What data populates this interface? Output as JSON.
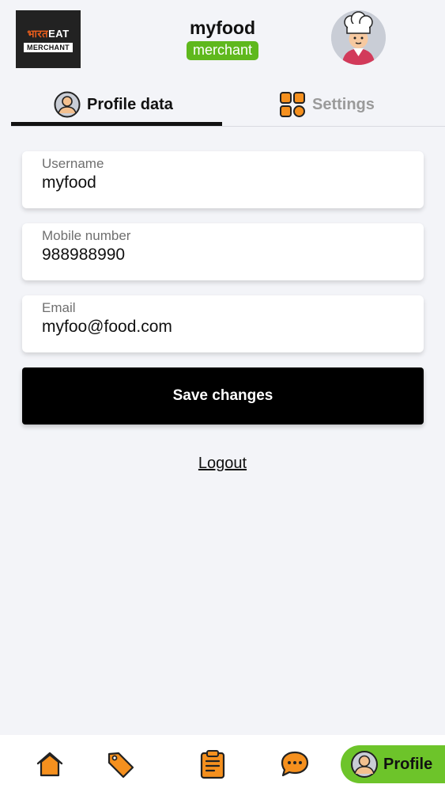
{
  "header": {
    "logo_top_a": "भारत",
    "logo_top_b": "EAT",
    "logo_bottom": "MERCHANT",
    "title": "myfood",
    "badge": "merchant"
  },
  "tabs": [
    {
      "label": "Profile data",
      "active": true
    },
    {
      "label": "Settings",
      "active": false
    }
  ],
  "form": {
    "username": {
      "label": "Username",
      "value": "myfood"
    },
    "mobile": {
      "label": "Mobile number",
      "value": "988988990"
    },
    "email": {
      "label": "Email",
      "value": "myfoo@food.com"
    },
    "save_label": "Save changes"
  },
  "logout_label": "Logout",
  "bottom_nav": {
    "items": [
      "home-icon",
      "tag-icon",
      "clipboard-icon",
      "chat-icon"
    ],
    "active_label": "Profile"
  },
  "colors": {
    "accent_green": "#5fb81d",
    "icon_orange": "#f5901e",
    "primary_button": "#000000"
  }
}
